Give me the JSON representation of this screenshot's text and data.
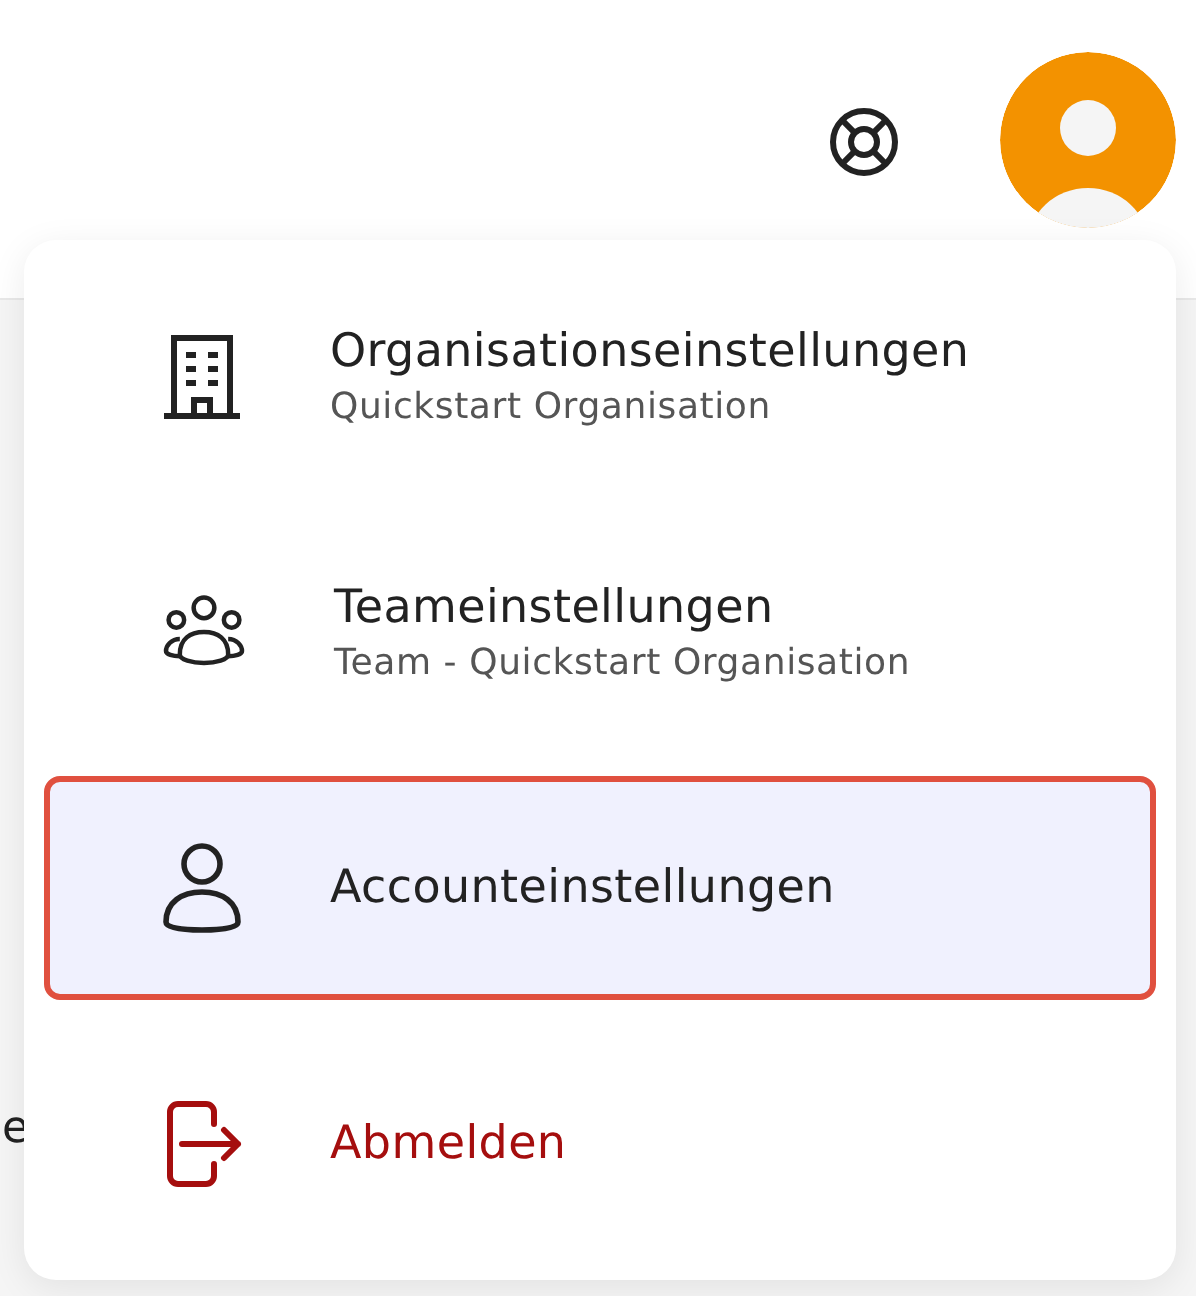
{
  "background_text": "e",
  "header": {
    "avatar": {
      "kind": "person"
    }
  },
  "menu": {
    "items": [
      {
        "kind": "building",
        "title": "Organisationseinstellungen",
        "subtitle": "Quickstart Organisation",
        "selected": false
      },
      {
        "kind": "team",
        "title": "Teameinstellungen",
        "subtitle": "Team - Quickstart Organisation",
        "selected": false
      },
      {
        "kind": "person",
        "title": "Accounteinstellungen",
        "selected": true
      },
      {
        "kind": "logout",
        "title": "Abmelden",
        "selected": false
      }
    ]
  }
}
